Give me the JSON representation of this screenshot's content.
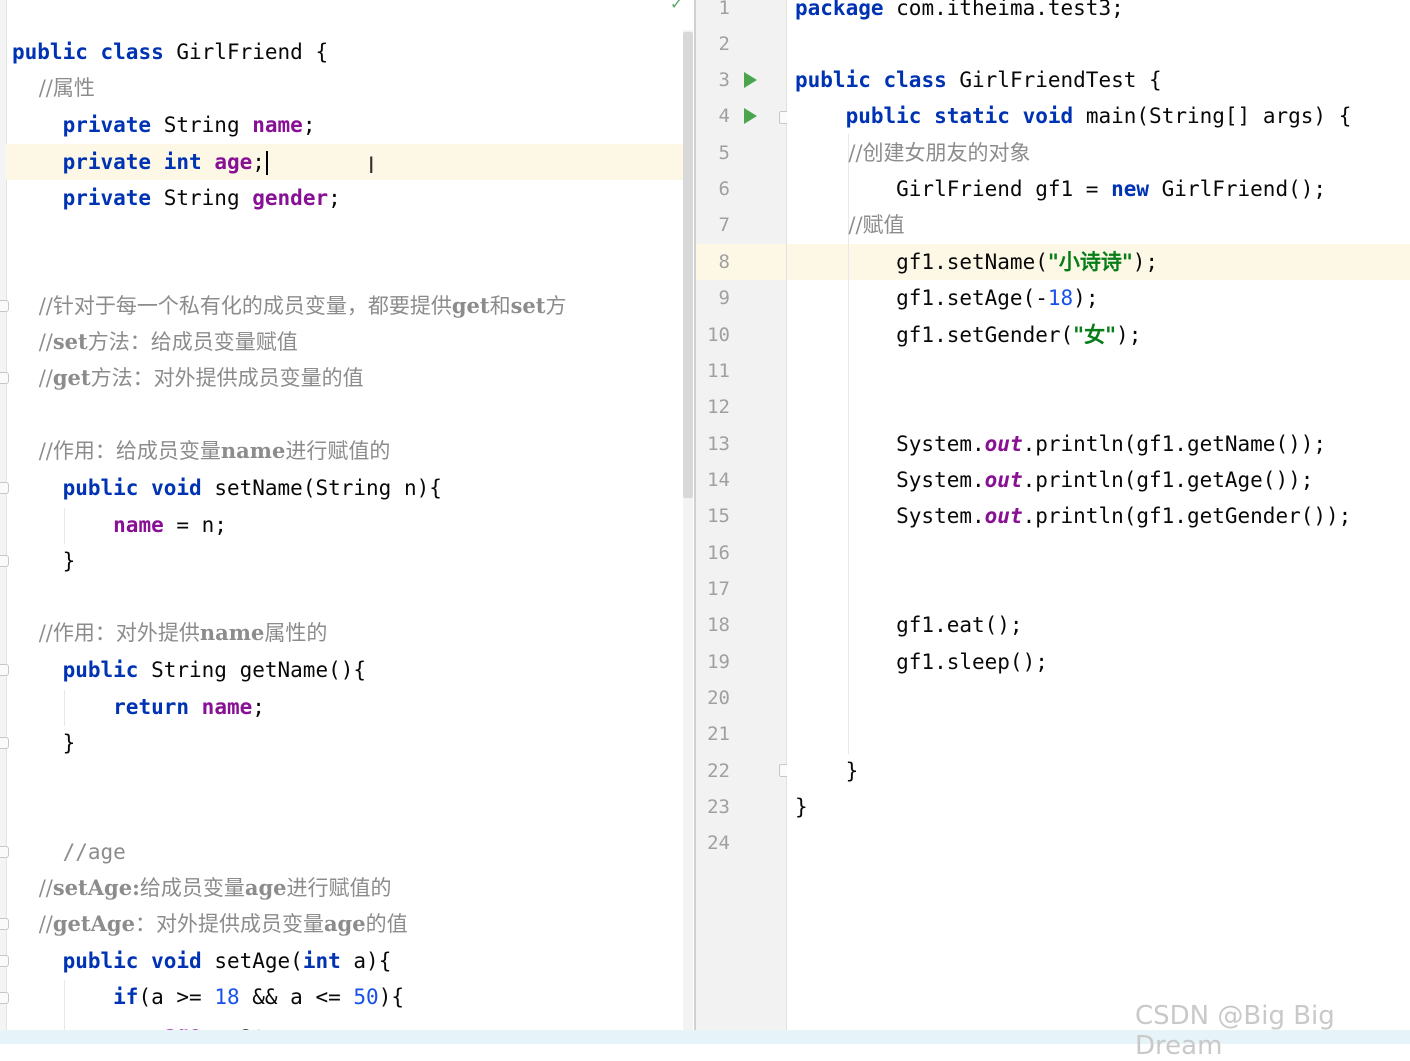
{
  "left_editor": {
    "lines": [
      "public class GirlFriend {",
      "    //属性",
      "    private String name;",
      "    private int age;",
      "    private String gender;",
      "",
      "",
      "    //针对于每一个私有化的成员变量，都要提供get和set方",
      "    //set方法：给成员变量赋值",
      "    //get方法：对外提供成员变量的值",
      "",
      "    //作用：给成员变量name进行赋值的",
      "    public void setName(String n){",
      "        name = n;",
      "    }",
      "",
      "    //作用：对外提供name属性的",
      "    public String getName(){",
      "        return name;",
      "    }",
      "",
      "",
      "    //age",
      "    //setAge:给成员变量age进行赋值的",
      "    //getAge：对外提供成员变量age的值",
      "    public void setAge(int a){",
      "        if(a >= 18 && a <= 50){",
      "            age = a;"
    ]
  },
  "right_editor": {
    "line_numbers": [
      "1",
      "2",
      "3",
      "4",
      "5",
      "6",
      "7",
      "8",
      "9",
      "10",
      "11",
      "12",
      "13",
      "14",
      "15",
      "16",
      "17",
      "18",
      "19",
      "20",
      "21",
      "22",
      "23",
      "24"
    ],
    "lines": [
      "package com.itheima.test3;",
      "",
      "public class GirlFriendTest {",
      "    public static void main(String[] args) {",
      "        //创建女朋友的对象",
      "        GirlFriend gf1 = new GirlFriend();",
      "        //赋值",
      "        gf1.setName(\"小诗诗\");",
      "        gf1.setAge(-18);",
      "        gf1.setGender(\"女\");",
      "",
      "",
      "        System.out.println(gf1.getName());",
      "        System.out.println(gf1.getAge());",
      "        System.out.println(gf1.getGender());",
      "",
      "",
      "        gf1.eat();",
      "        gf1.sleep();",
      "",
      "",
      "    }",
      "}",
      ""
    ]
  },
  "watermark": "CSDN @Big Big Dream",
  "icons": {
    "run": "run-gutter-icon",
    "fold": "fold-icon",
    "check": "inspection-ok-icon",
    "text_cursor": "text-cursor-icon"
  },
  "colors": {
    "keyword": "#0033b3",
    "field": "#871094",
    "number": "#1750eb",
    "string": "#067d17",
    "comment": "#8c8c8c",
    "current_line": "#fdf8e6",
    "run_icon": "#4aa54f"
  }
}
